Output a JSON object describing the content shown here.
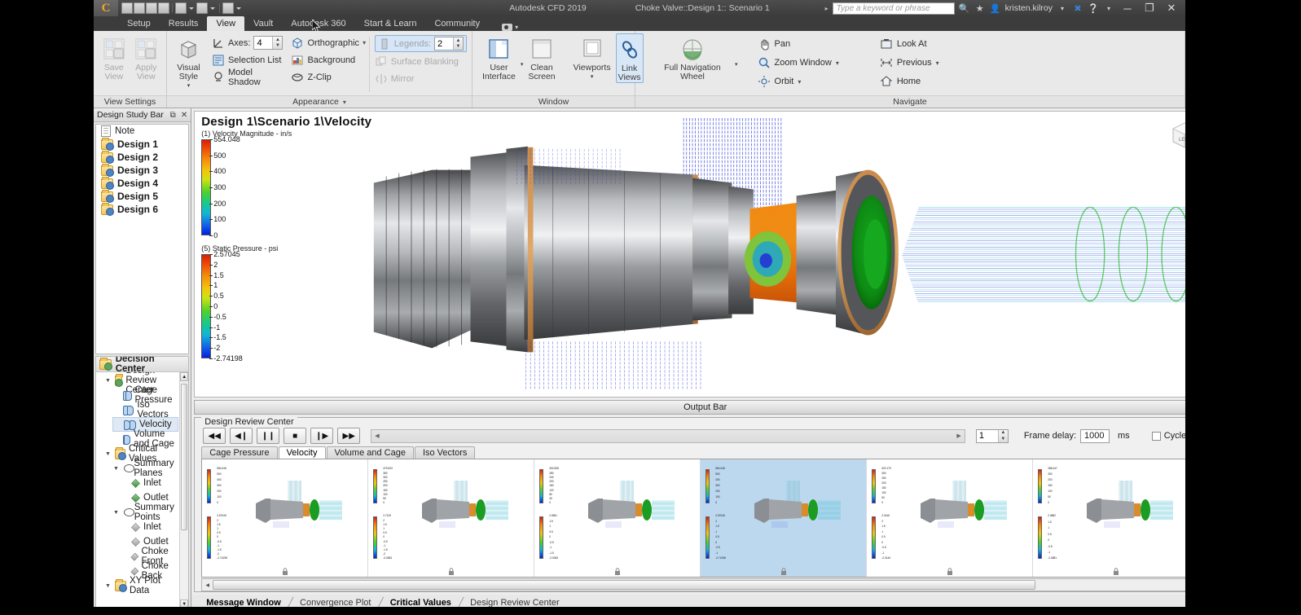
{
  "titlebar": {
    "app_name": "Autodesk CFD 2019",
    "document_title": "Choke Valve::Design 1:: Scenario 1",
    "search_placeholder": "Type a keyword or phrase",
    "user": "kristen.kilroy",
    "logo_letter": "C",
    "minimize": "─",
    "maximize": "❐",
    "close": "✕"
  },
  "menu": {
    "tabs": [
      {
        "label": "Setup",
        "active": false
      },
      {
        "label": "Results",
        "active": false
      },
      {
        "label": "View",
        "active": true
      },
      {
        "label": "Vault",
        "active": false
      },
      {
        "label": "Autodesk 360",
        "active": false
      },
      {
        "label": "Start & Learn",
        "active": false
      },
      {
        "label": "Community",
        "active": false
      }
    ]
  },
  "ribbon": {
    "panels": [
      {
        "title": "View Settings"
      },
      {
        "title": "Appearance",
        "has_dropdown": true
      },
      {
        "title": "Window"
      },
      {
        "title": "Navigate"
      }
    ],
    "view_settings": {
      "save_view": {
        "line1": "Save",
        "line2": "View"
      },
      "apply_view": {
        "line1": "Apply",
        "line2": "View"
      }
    },
    "appearance": {
      "visual_style": "Visual Style",
      "axes_label": "Axes:",
      "axes_value": "4",
      "selection_list": "Selection List",
      "model_shadow": "Model Shadow",
      "orthographic": "Orthographic",
      "background": "Background",
      "z_clip": "Z-Clip",
      "legends_label": "Legends:",
      "legends_value": "2",
      "surface_blanking": "Surface Blanking",
      "mirror": "Mirror"
    },
    "window": {
      "user_interface": {
        "line1": "User",
        "line2": "Interface"
      },
      "clean_screen": {
        "line1": "Clean",
        "line2": "Screen"
      },
      "viewports": "Viewports",
      "link_views": {
        "line1": "Link",
        "line2": "Views"
      }
    },
    "navigate": {
      "full_navigation_wheel": {
        "line1": "Full Navigation",
        "line2": "Wheel"
      },
      "pan": "Pan",
      "zoom_window": "Zoom Window",
      "orbit": "Orbit",
      "look_at": "Look At",
      "previous": "Previous",
      "home": "Home"
    }
  },
  "design_study_bar": {
    "title": "Design Study Bar",
    "items": [
      {
        "label": "Note",
        "icon": "note-icon",
        "bold": false
      },
      {
        "label": "Design 1",
        "icon": "design-folder-icon",
        "bold": true
      },
      {
        "label": "Design 2",
        "icon": "design-folder-icon",
        "bold": true
      },
      {
        "label": "Design 3",
        "icon": "design-folder-icon",
        "bold": true
      },
      {
        "label": "Design 4",
        "icon": "design-folder-icon",
        "bold": true
      },
      {
        "label": "Design 5",
        "icon": "design-folder-icon",
        "bold": true
      },
      {
        "label": "Design 6",
        "icon": "design-folder-icon",
        "bold": true
      }
    ]
  },
  "decision_center": {
    "title": "Decision Center",
    "nodes": [
      {
        "label": "Design Review Center",
        "indent": 1,
        "icon": "folder-icon",
        "expander": "▼",
        "selected": false
      },
      {
        "label": "Cage Pressure",
        "indent": 2,
        "icon": "glasses-icon",
        "expander": "",
        "selected": false
      },
      {
        "label": "Iso Vectors",
        "indent": 2,
        "icon": "glasses-icon",
        "expander": "",
        "selected": false
      },
      {
        "label": "Velocity",
        "indent": 2,
        "icon": "glasses-icon",
        "expander": "",
        "selected": true
      },
      {
        "label": "Volume and Cage",
        "indent": 2,
        "icon": "glasses-icon",
        "expander": "",
        "selected": false
      },
      {
        "label": "Critical Values",
        "indent": 1,
        "icon": "grid-folder-icon",
        "expander": "▼",
        "selected": false
      },
      {
        "label": "Summary Planes",
        "indent": 2,
        "icon": "plane-icon",
        "expander": "▼",
        "selected": false
      },
      {
        "label": "Inlet",
        "indent": 3,
        "icon": "green-diamond-icon",
        "expander": "",
        "selected": false
      },
      {
        "label": "Outlet",
        "indent": 3,
        "icon": "green-diamond-icon",
        "expander": "",
        "selected": false
      },
      {
        "label": "Summary Points",
        "indent": 2,
        "icon": "points-icon",
        "expander": "▼",
        "selected": false
      },
      {
        "label": "Inlet",
        "indent": 3,
        "icon": "gray-diamond-icon",
        "expander": "",
        "selected": false
      },
      {
        "label": "Outlet",
        "indent": 3,
        "icon": "gray-diamond-icon",
        "expander": "",
        "selected": false
      },
      {
        "label": "Choke Front",
        "indent": 3,
        "icon": "gray-diamond-icon",
        "expander": "",
        "selected": false
      },
      {
        "label": "Choke Back",
        "indent": 3,
        "icon": "gray-diamond-icon",
        "expander": "",
        "selected": false
      },
      {
        "label": "XY Plot Data",
        "indent": 1,
        "icon": "chart-folder-icon",
        "expander": "▼",
        "selected": false
      }
    ]
  },
  "viewport": {
    "title": "Design 1\\Scenario 1\\Velocity",
    "legends": [
      {
        "caption": "(1) Velocity Magnitude - in/s",
        "ticks": [
          "554.048",
          "500",
          "400",
          "300",
          "200",
          "100",
          "0"
        ],
        "max": 554.048,
        "min": 0
      },
      {
        "caption": "(5) Static Pressure - psi",
        "ticks": [
          "2.57045",
          "2",
          "1.5",
          "1",
          "0.5",
          "0",
          "-0.5",
          "-1",
          "-1.5",
          "-2",
          "-2.74198"
        ],
        "max": 2.57045,
        "min": -2.74198
      }
    ],
    "viewcube_face": "LEFT"
  },
  "output_bar": {
    "title": "Output Bar"
  },
  "design_review_center": {
    "group_label": "Design Review Center",
    "playback": [
      {
        "name": "rewind-button",
        "glyph": "◀◀"
      },
      {
        "name": "step-back-button",
        "glyph": "◀❙"
      },
      {
        "name": "pause-button",
        "glyph": "❙❙"
      },
      {
        "name": "stop-button",
        "glyph": "■"
      },
      {
        "name": "step-forward-button",
        "glyph": "❙▶"
      },
      {
        "name": "fast-forward-button",
        "glyph": "▶▶"
      }
    ],
    "frame_value": "1",
    "frame_delay_label": "Frame delay:",
    "frame_delay_value": "1000",
    "frame_delay_unit": "ms",
    "cycle_label": "Cycle",
    "cycle_checked": false,
    "help_glyph": "?",
    "tabs": [
      {
        "label": "Cage Pressure",
        "active": false
      },
      {
        "label": "Velocity",
        "active": true
      },
      {
        "label": "Volume and Cage",
        "active": false
      },
      {
        "label": "Iso Vectors",
        "active": false
      }
    ],
    "thumbnails": [
      {
        "index": 1,
        "selected": false,
        "velocity_ticks": [
          "554.048",
          "500",
          "400",
          "300",
          "200",
          "100",
          "0"
        ],
        "pressure_ticks": [
          "2.57045",
          "2",
          "1.5",
          "1",
          "0.5",
          "0",
          "-0.5",
          "-1",
          "-1.5",
          "-2",
          "-2.74198"
        ]
      },
      {
        "index": 2,
        "selected": false,
        "velocity_ticks": [
          "379.633",
          "350",
          "300",
          "250",
          "200",
          "150",
          "100",
          "50",
          "0"
        ],
        "pressure_ticks": [
          "2.7129",
          "2",
          "1.5",
          "1",
          "0.5",
          "0",
          "-0.5",
          "-1",
          "-1.5",
          "-2",
          "-3.0563"
        ]
      },
      {
        "index": 3,
        "selected": false,
        "velocity_ticks": [
          "302.838",
          "280",
          "240",
          "200",
          "160",
          "120",
          "80",
          "40",
          "0"
        ],
        "pressure_ticks": [
          "2.0561",
          "1.5",
          "1",
          "0.5",
          "0",
          "-0.5",
          "-1",
          "-1.5",
          "-2.0063"
        ]
      },
      {
        "index": 4,
        "selected": true,
        "velocity_ticks": [
          "554.048",
          "500",
          "400",
          "300",
          "200",
          "100",
          "0"
        ],
        "pressure_ticks": [
          "2.57045",
          "2",
          "1.5",
          "1",
          "0.5",
          "0",
          "-0.5",
          "-1",
          "-2.74198"
        ]
      },
      {
        "index": 5,
        "selected": false,
        "velocity_ticks": [
          "322.179",
          "300",
          "250",
          "200",
          "150",
          "100",
          "50",
          "0"
        ],
        "pressure_ticks": [
          "2.3145",
          "2",
          "1.5",
          "1",
          "0.5",
          "0",
          "-0.5",
          "-1",
          "-2.3144"
        ]
      },
      {
        "index": 6,
        "selected": false,
        "velocity_ticks": [
          "288.447",
          "250",
          "200",
          "150",
          "100",
          "50",
          "0"
        ],
        "pressure_ticks": [
          "2.0882",
          "1.5",
          "1",
          "0.5",
          "0",
          "-0.5",
          "-1",
          "-2.0881"
        ]
      }
    ]
  },
  "bottom_tabs": [
    {
      "label": "Message Window",
      "active": true
    },
    {
      "label": "Convergence Plot",
      "active": false
    },
    {
      "label": "Critical Values",
      "active": true
    },
    {
      "label": "Design Review Center",
      "active": false
    }
  ],
  "colors": {
    "accent": "#2f6ea5",
    "ribbon_bg": "#e9e9e9",
    "titlebar_bg": "#3c3c3c",
    "selection": "#bcd8ef",
    "legend_hot": "#d81e06",
    "legend_cold": "#0020e0"
  }
}
